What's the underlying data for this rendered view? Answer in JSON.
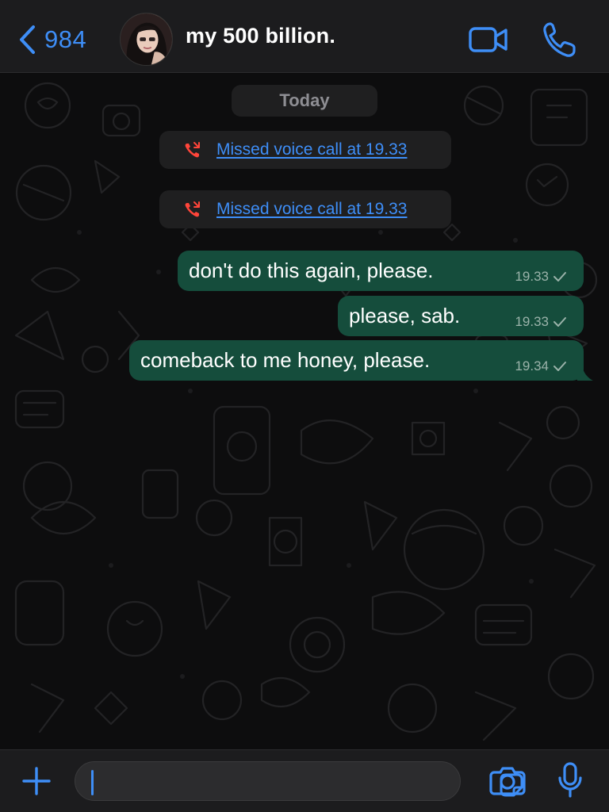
{
  "header": {
    "back_count": "984",
    "contact_name": "my 500 billion.",
    "icons": {
      "back": "chevron-left-icon",
      "avatar": "contact-avatar",
      "video": "video-camera-icon",
      "call": "phone-icon"
    }
  },
  "chat": {
    "date_label": "Today",
    "missed_calls": [
      {
        "text": "Missed voice call at 19.33",
        "icon": "missed-call-icon"
      },
      {
        "text": "Missed voice call at 19.33",
        "icon": "missed-call-icon"
      }
    ],
    "messages": [
      {
        "text": "don't do this again, please.",
        "time": "19.33",
        "status": "sent"
      },
      {
        "text": "please, sab.",
        "time": "19.33",
        "status": "sent"
      },
      {
        "text": "comeback to me honey, please.",
        "time": "19.34",
        "status": "sent"
      }
    ]
  },
  "input_bar": {
    "value": "",
    "icons": [
      "plus-icon",
      "sticker-icon",
      "camera-icon",
      "microphone-icon"
    ]
  },
  "colors": {
    "accent": "#3e8ef7",
    "outgoing_bubble": "#154d3c",
    "missed_call_red": "#ff453a",
    "header_bg": "#1c1c1e"
  }
}
